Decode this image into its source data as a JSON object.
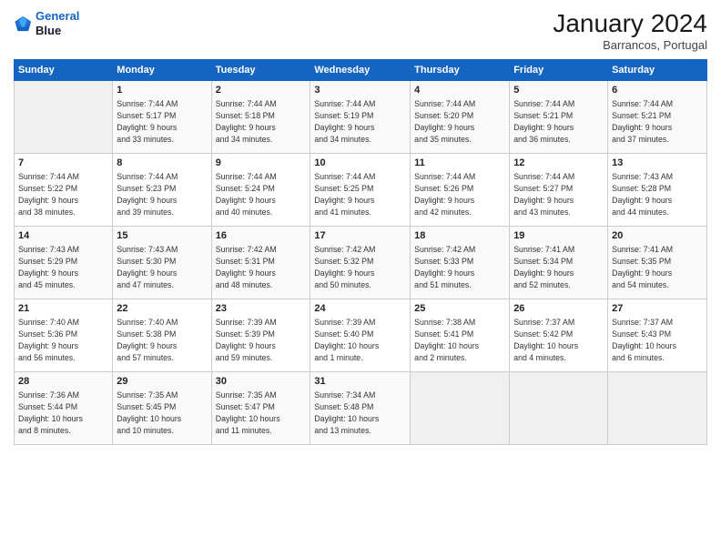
{
  "header": {
    "logo_line1": "General",
    "logo_line2": "Blue",
    "month_title": "January 2024",
    "subtitle": "Barrancos, Portugal"
  },
  "weekdays": [
    "Sunday",
    "Monday",
    "Tuesday",
    "Wednesday",
    "Thursday",
    "Friday",
    "Saturday"
  ],
  "weeks": [
    [
      {
        "day": "",
        "info": ""
      },
      {
        "day": "1",
        "info": "Sunrise: 7:44 AM\nSunset: 5:17 PM\nDaylight: 9 hours\nand 33 minutes."
      },
      {
        "day": "2",
        "info": "Sunrise: 7:44 AM\nSunset: 5:18 PM\nDaylight: 9 hours\nand 34 minutes."
      },
      {
        "day": "3",
        "info": "Sunrise: 7:44 AM\nSunset: 5:19 PM\nDaylight: 9 hours\nand 34 minutes."
      },
      {
        "day": "4",
        "info": "Sunrise: 7:44 AM\nSunset: 5:20 PM\nDaylight: 9 hours\nand 35 minutes."
      },
      {
        "day": "5",
        "info": "Sunrise: 7:44 AM\nSunset: 5:21 PM\nDaylight: 9 hours\nand 36 minutes."
      },
      {
        "day": "6",
        "info": "Sunrise: 7:44 AM\nSunset: 5:21 PM\nDaylight: 9 hours\nand 37 minutes."
      }
    ],
    [
      {
        "day": "7",
        "info": "Sunrise: 7:44 AM\nSunset: 5:22 PM\nDaylight: 9 hours\nand 38 minutes."
      },
      {
        "day": "8",
        "info": "Sunrise: 7:44 AM\nSunset: 5:23 PM\nDaylight: 9 hours\nand 39 minutes."
      },
      {
        "day": "9",
        "info": "Sunrise: 7:44 AM\nSunset: 5:24 PM\nDaylight: 9 hours\nand 40 minutes."
      },
      {
        "day": "10",
        "info": "Sunrise: 7:44 AM\nSunset: 5:25 PM\nDaylight: 9 hours\nand 41 minutes."
      },
      {
        "day": "11",
        "info": "Sunrise: 7:44 AM\nSunset: 5:26 PM\nDaylight: 9 hours\nand 42 minutes."
      },
      {
        "day": "12",
        "info": "Sunrise: 7:44 AM\nSunset: 5:27 PM\nDaylight: 9 hours\nand 43 minutes."
      },
      {
        "day": "13",
        "info": "Sunrise: 7:43 AM\nSunset: 5:28 PM\nDaylight: 9 hours\nand 44 minutes."
      }
    ],
    [
      {
        "day": "14",
        "info": "Sunrise: 7:43 AM\nSunset: 5:29 PM\nDaylight: 9 hours\nand 45 minutes."
      },
      {
        "day": "15",
        "info": "Sunrise: 7:43 AM\nSunset: 5:30 PM\nDaylight: 9 hours\nand 47 minutes."
      },
      {
        "day": "16",
        "info": "Sunrise: 7:42 AM\nSunset: 5:31 PM\nDaylight: 9 hours\nand 48 minutes."
      },
      {
        "day": "17",
        "info": "Sunrise: 7:42 AM\nSunset: 5:32 PM\nDaylight: 9 hours\nand 50 minutes."
      },
      {
        "day": "18",
        "info": "Sunrise: 7:42 AM\nSunset: 5:33 PM\nDaylight: 9 hours\nand 51 minutes."
      },
      {
        "day": "19",
        "info": "Sunrise: 7:41 AM\nSunset: 5:34 PM\nDaylight: 9 hours\nand 52 minutes."
      },
      {
        "day": "20",
        "info": "Sunrise: 7:41 AM\nSunset: 5:35 PM\nDaylight: 9 hours\nand 54 minutes."
      }
    ],
    [
      {
        "day": "21",
        "info": "Sunrise: 7:40 AM\nSunset: 5:36 PM\nDaylight: 9 hours\nand 56 minutes."
      },
      {
        "day": "22",
        "info": "Sunrise: 7:40 AM\nSunset: 5:38 PM\nDaylight: 9 hours\nand 57 minutes."
      },
      {
        "day": "23",
        "info": "Sunrise: 7:39 AM\nSunset: 5:39 PM\nDaylight: 9 hours\nand 59 minutes."
      },
      {
        "day": "24",
        "info": "Sunrise: 7:39 AM\nSunset: 5:40 PM\nDaylight: 10 hours\nand 1 minute."
      },
      {
        "day": "25",
        "info": "Sunrise: 7:38 AM\nSunset: 5:41 PM\nDaylight: 10 hours\nand 2 minutes."
      },
      {
        "day": "26",
        "info": "Sunrise: 7:37 AM\nSunset: 5:42 PM\nDaylight: 10 hours\nand 4 minutes."
      },
      {
        "day": "27",
        "info": "Sunrise: 7:37 AM\nSunset: 5:43 PM\nDaylight: 10 hours\nand 6 minutes."
      }
    ],
    [
      {
        "day": "28",
        "info": "Sunrise: 7:36 AM\nSunset: 5:44 PM\nDaylight: 10 hours\nand 8 minutes."
      },
      {
        "day": "29",
        "info": "Sunrise: 7:35 AM\nSunset: 5:45 PM\nDaylight: 10 hours\nand 10 minutes."
      },
      {
        "day": "30",
        "info": "Sunrise: 7:35 AM\nSunset: 5:47 PM\nDaylight: 10 hours\nand 11 minutes."
      },
      {
        "day": "31",
        "info": "Sunrise: 7:34 AM\nSunset: 5:48 PM\nDaylight: 10 hours\nand 13 minutes."
      },
      {
        "day": "",
        "info": ""
      },
      {
        "day": "",
        "info": ""
      },
      {
        "day": "",
        "info": ""
      }
    ]
  ]
}
